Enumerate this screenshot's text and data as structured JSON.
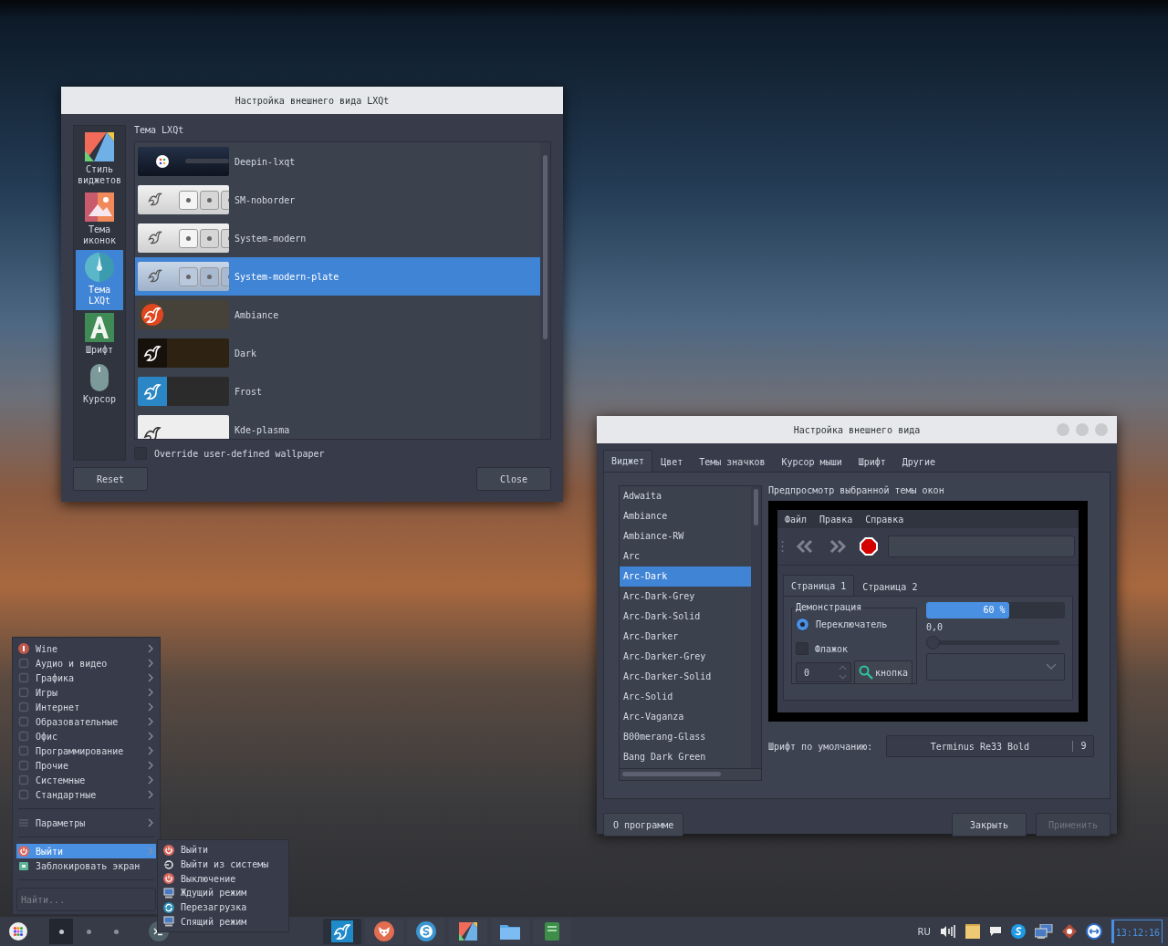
{
  "lxqt_window": {
    "title": "Настройка внешнего вида LXQt",
    "sidebar": [
      {
        "label": "Стиль виджетов",
        "selected": false
      },
      {
        "label": "Тема иконок",
        "selected": false
      },
      {
        "label": "Тема LXQt",
        "selected": true
      },
      {
        "label": "Шрифт",
        "selected": false
      },
      {
        "label": "Курсор",
        "selected": false
      }
    ],
    "section_title": "Тема LXQt",
    "themes": [
      {
        "name": "Deepin-lxqt",
        "kind": "deepin",
        "selected": false
      },
      {
        "name": "SM-noborder",
        "kind": "light",
        "selected": false
      },
      {
        "name": "System-modern",
        "kind": "light",
        "selected": false
      },
      {
        "name": "System-modern-plate",
        "kind": "plate",
        "selected": true
      },
      {
        "name": "Ambiance",
        "kind": "ambiance",
        "selected": false
      },
      {
        "name": "Dark",
        "kind": "dark",
        "selected": false
      },
      {
        "name": "Frost",
        "kind": "frost",
        "selected": false
      },
      {
        "name": "Kde-plasma",
        "kind": "plasma",
        "selected": false
      }
    ],
    "override_wallpaper": {
      "label": "Override user-defined wallpaper",
      "checked": false
    },
    "buttons": [
      "Reset",
      "Close"
    ]
  },
  "appearance_window": {
    "title": "Настройка внешнего вида",
    "tabs": [
      {
        "label": "Виджет",
        "selected": true
      },
      {
        "label": "Цвет",
        "selected": false
      },
      {
        "label": "Темы значков",
        "selected": false
      },
      {
        "label": "Курсор мыши",
        "selected": false
      },
      {
        "label": "Шрифт",
        "selected": false
      },
      {
        "label": "Другие",
        "selected": false
      }
    ],
    "themes": [
      {
        "name": "Adwaita",
        "selected": false
      },
      {
        "name": "Ambiance",
        "selected": false
      },
      {
        "name": "Ambiance-RW",
        "selected": false
      },
      {
        "name": "Arc",
        "selected": false
      },
      {
        "name": "Arc-Dark",
        "selected": true
      },
      {
        "name": "Arc-Dark-Grey",
        "selected": false
      },
      {
        "name": "Arc-Dark-Solid",
        "selected": false
      },
      {
        "name": "Arc-Darker",
        "selected": false
      },
      {
        "name": "Arc-Darker-Grey",
        "selected": false
      },
      {
        "name": "Arc-Darker-Solid",
        "selected": false
      },
      {
        "name": "Arc-Solid",
        "selected": false
      },
      {
        "name": "Arc-Vaganza",
        "selected": false
      },
      {
        "name": "B00merang-Glass",
        "selected": false
      },
      {
        "name": "Bang Dark Green",
        "selected": false
      }
    ],
    "preview_title": "Предпросмотр выбранной темы окон",
    "preview": {
      "menu": [
        "Файл",
        "Правка",
        "Справка"
      ],
      "tabs": [
        {
          "label": "Страница 1",
          "selected": true
        },
        {
          "label": "Страница 2",
          "selected": false
        }
      ],
      "group_title": "Демонстрация",
      "radio": {
        "label": "Переключатель",
        "checked": true
      },
      "checkbox": {
        "label": "Флажок",
        "checked": false
      },
      "spin_value": "0",
      "button": "кнопка",
      "progress": {
        "level": 0.6,
        "reading": "60 %"
      },
      "slider": {
        "reading": "0,0",
        "level": 0
      }
    },
    "default_font": {
      "label": "Шрифт по умолчанию:",
      "family": "Terminus Re33 Bold",
      "size": "9"
    },
    "buttons": [
      {
        "label": "О программе",
        "disabled": false
      },
      {
        "label": "Закрыть",
        "disabled": false
      },
      {
        "label": "Применить",
        "disabled": true
      }
    ]
  },
  "start_menu": {
    "sections": [
      [
        {
          "label": "Wine",
          "submenu": true,
          "selected": false
        },
        {
          "label": "Аудио и видео",
          "submenu": true,
          "selected": false
        },
        {
          "label": "Графика",
          "submenu": true,
          "selected": false
        },
        {
          "label": "Игры",
          "submenu": true,
          "selected": false
        },
        {
          "label": "Интернет",
          "submenu": true,
          "selected": false
        },
        {
          "label": "Образовательные",
          "submenu": true,
          "selected": false
        },
        {
          "label": "Офис",
          "submenu": true,
          "selected": false
        },
        {
          "label": "Программирование",
          "submenu": true,
          "selected": false
        },
        {
          "label": "Прочие",
          "submenu": true,
          "selected": false
        },
        {
          "label": "Системные",
          "submenu": true,
          "selected": false
        },
        {
          "label": "Стандартные",
          "submenu": true,
          "selected": false
        }
      ],
      [
        {
          "label": "Параметры",
          "submenu": true,
          "selected": false
        }
      ],
      [
        {
          "label": "Выйти",
          "submenu": true,
          "selected": true
        },
        {
          "label": "Заблокировать экран",
          "submenu": false,
          "selected": false
        }
      ]
    ],
    "search": {
      "placeholder": "Найти..."
    }
  },
  "submenu": {
    "items": [
      "Выйти",
      "Выйти из системы",
      "Выключение",
      "Ждущий режим",
      "Перезагрузка",
      "Спящий режим"
    ]
  },
  "taskbar": {
    "desktops": [
      {
        "selected": true
      },
      {
        "selected": false
      },
      {
        "selected": false
      }
    ],
    "tasks": [
      {
        "selected": true
      },
      {
        "selected": false
      },
      {
        "selected": false
      },
      {
        "selected": false
      },
      {
        "selected": false
      },
      {
        "selected": false
      }
    ],
    "keyboard_layout": "RU",
    "clock": "13:12:16"
  }
}
